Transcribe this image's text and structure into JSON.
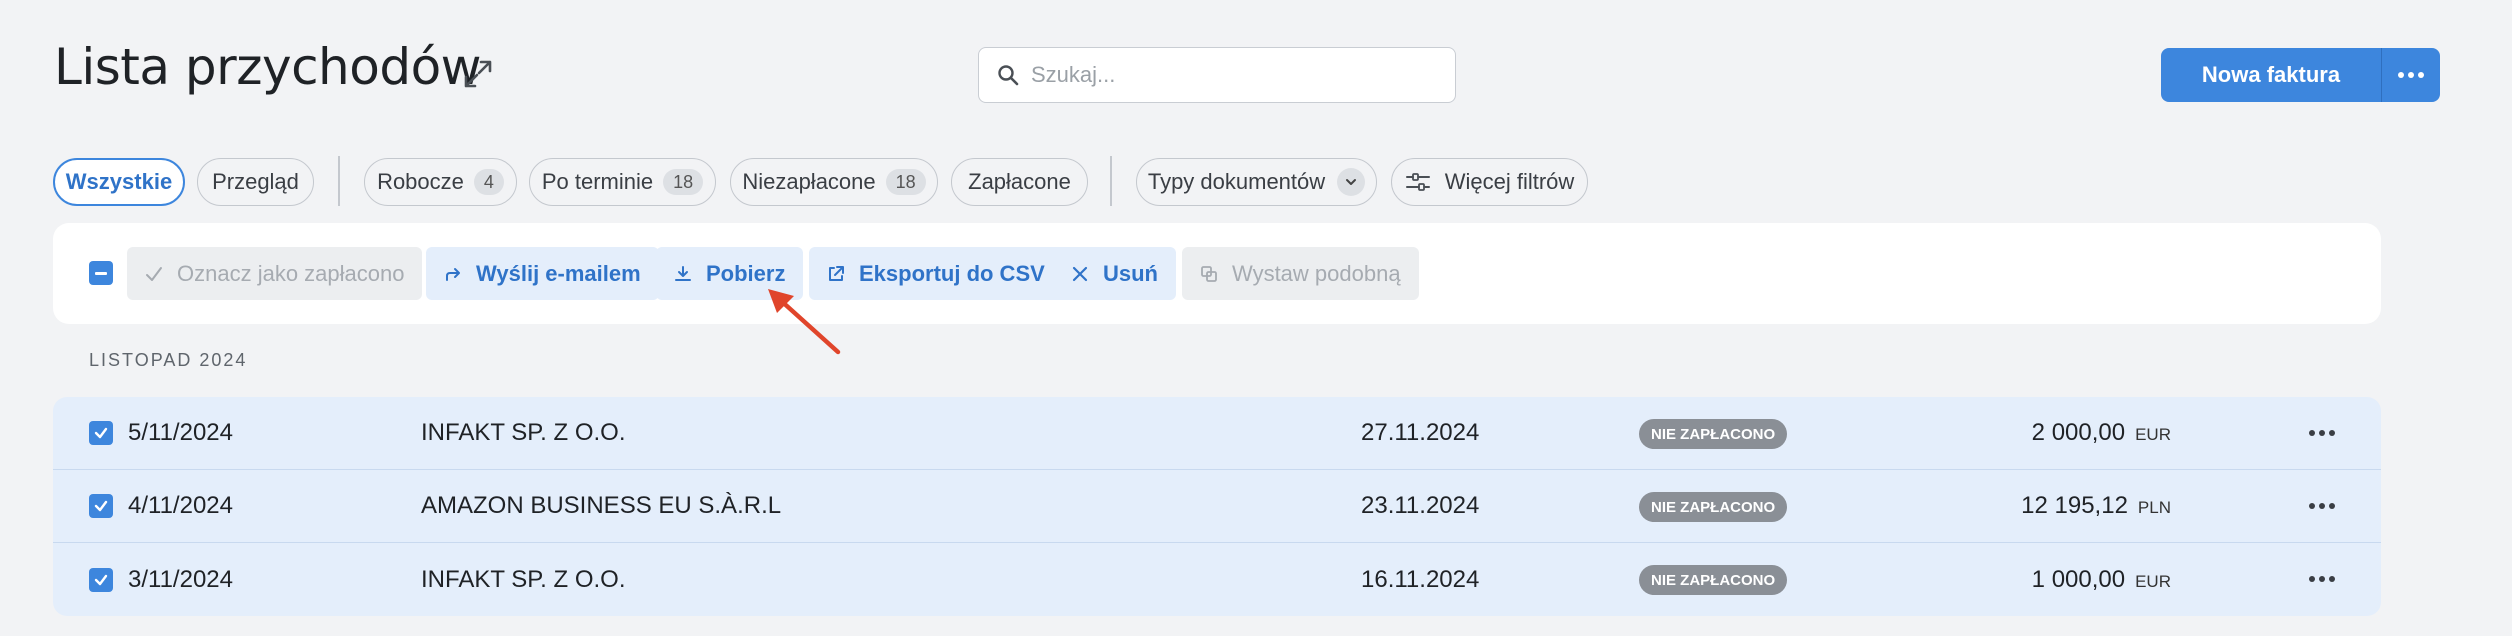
{
  "header": {
    "title": "Lista przychodów",
    "search_placeholder": "Szukaj...",
    "new_invoice_label": "Nowa faktura"
  },
  "filters": {
    "all": "Wszystkie",
    "overview": "Przegląd",
    "drafts": "Robocze",
    "drafts_count": "4",
    "overdue": "Po terminie",
    "overdue_count": "18",
    "unpaid": "Niezapłacone",
    "unpaid_count": "18",
    "paid": "Zapłacone",
    "doc_types": "Typy dokumentów",
    "more_filters": "Więcej filtrów"
  },
  "actions": {
    "mark_paid": "Oznacz jako zapłacono",
    "send_email": "Wyślij e-mailem",
    "download": "Pobierz",
    "export_csv": "Eksportuj do CSV",
    "delete": "Usuń",
    "issue_similar": "Wystaw podobną"
  },
  "month_label": "LISTOPAD 2024",
  "invoices": [
    {
      "number": "5/11/2024",
      "client": "INFAKT SP. Z O.O.",
      "due_date": "27.11.2024",
      "status": "NIE ZAPŁACONO",
      "amount": "2 000,00",
      "currency": "EUR"
    },
    {
      "number": "4/11/2024",
      "client": "AMAZON BUSINESS EU S.À.R.L",
      "due_date": "23.11.2024",
      "status": "NIE ZAPŁACONO",
      "amount": "12 195,12",
      "currency": "PLN"
    },
    {
      "number": "3/11/2024",
      "client": "INFAKT SP. Z O.O.",
      "due_date": "16.11.2024",
      "status": "NIE ZAPŁACONO",
      "amount": "1 000,00",
      "currency": "EUR"
    }
  ],
  "colors": {
    "accent": "#3d86dd",
    "status_badge": "#8a8f96",
    "annotation_arrow": "#e0452b"
  }
}
